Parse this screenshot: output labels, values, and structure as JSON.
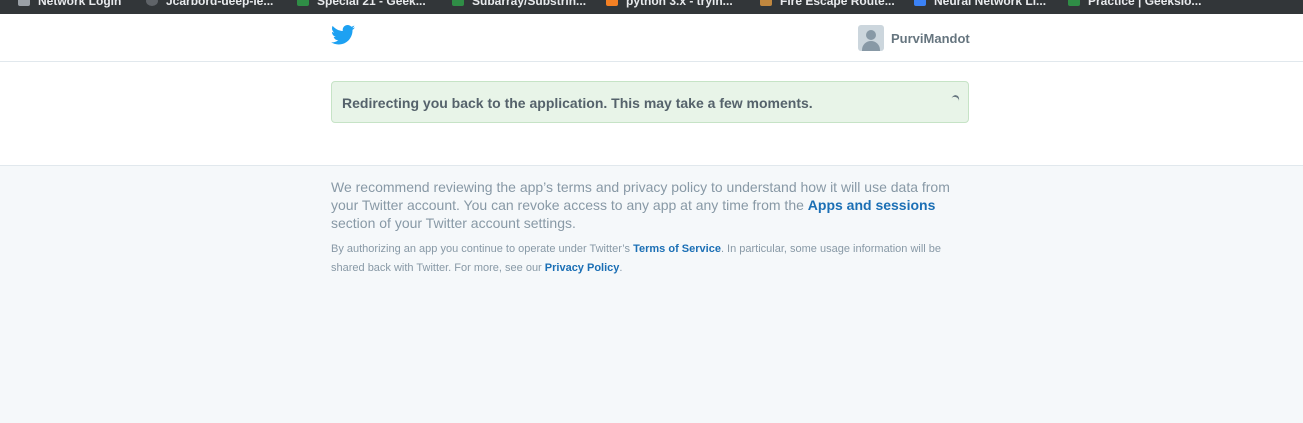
{
  "bookmarks": [
    {
      "label": "Network Login",
      "icon": "page-icon",
      "color": "#9aa0a6"
    },
    {
      "label": "Jcarbord-deep-le...",
      "icon": "github-icon",
      "color": "#5f6368"
    },
    {
      "label": "Special 21 - Geek...",
      "icon": "geeksforgeeks-icon",
      "color": "#2f8d46"
    },
    {
      "label": "Subarray/Substrin...",
      "icon": "geeksforgeeks-icon",
      "color": "#2f8d46"
    },
    {
      "label": "python 3.x - tryin...",
      "icon": "stackoverflow-icon",
      "color": "#f48024"
    },
    {
      "label": "Fire Escape Route...",
      "icon": "bookmark-icon",
      "color": "#c0873f"
    },
    {
      "label": "Neural Network Li...",
      "icon": "document-icon",
      "color": "#3b82f6"
    },
    {
      "label": "Practice | GeeksIo...",
      "icon": "geeksforgeeks-icon",
      "color": "#2f8d46"
    }
  ],
  "header": {
    "logo_icon": "twitter-bird-icon",
    "username": "PurviMandot"
  },
  "alert": {
    "message": "Redirecting you back to the application. This may take a few moments."
  },
  "footer": {
    "recommend_text": "We recommend reviewing the app’s terms and privacy policy to understand how it will use data from your Twitter account. You can revoke access to any app at any time from the ",
    "apps_link": "Apps and sessions",
    "recommend_suffix": " section of your Twitter account settings.",
    "fine_text_1": "By authorizing an app you continue to operate under Twitter’s ",
    "terms_link": "Terms of Service",
    "fine_text_2": ". In particular, some usage information will be shared back with Twitter. For more, see our ",
    "privacy_link": "Privacy Policy",
    "fine_text_3": "."
  },
  "colors": {
    "twitter_blue": "#1da1f2",
    "link_blue": "#1b6fb5",
    "alert_bg": "#e8f4e8"
  }
}
